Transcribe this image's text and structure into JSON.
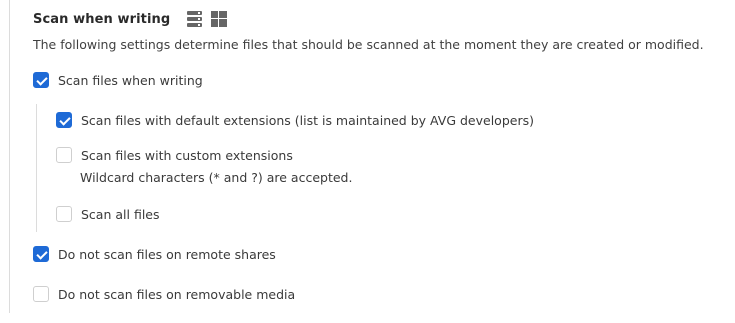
{
  "section": {
    "title": "Scan when writing",
    "description": "The following settings determine files that should be scanned at the moment they are created or modified."
  },
  "icons": {
    "server": "server-icon",
    "windows": "windows-icon"
  },
  "options": {
    "scan_files_when_writing": {
      "label": "Scan files when writing",
      "checked": true
    },
    "default_extensions": {
      "label": "Scan files with default extensions (list is maintained by AVG developers)",
      "checked": true
    },
    "custom_extensions": {
      "label": "Scan files with custom extensions",
      "note": "Wildcard characters (* and ?) are accepted.",
      "checked": false
    },
    "all_files": {
      "label": "Scan all files",
      "checked": false
    },
    "remote_shares": {
      "label": "Do not scan files on remote shares",
      "checked": true
    },
    "removable_media": {
      "label": "Do not scan files on removable media",
      "checked": false
    }
  },
  "colors": {
    "accent": "#1e6ad6",
    "text": "#3a3a3a",
    "rule": "#dcdcdc"
  }
}
